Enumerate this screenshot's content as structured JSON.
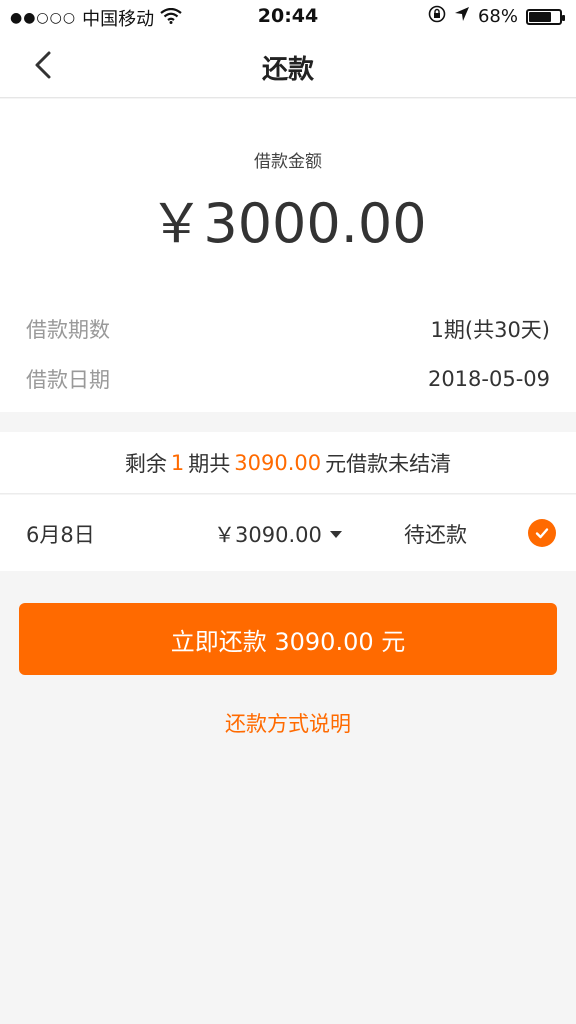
{
  "status_bar": {
    "signal_dots": "●●○○○",
    "carrier": "中国移动",
    "time": "20:44",
    "battery_text": "68%",
    "battery_level": 0.68
  },
  "nav": {
    "title": "还款"
  },
  "loan": {
    "amount_label": "借款金额",
    "amount_value": "￥3000.00",
    "term_label": "借款期数",
    "term_value": "1期(共30天)",
    "date_label": "借款日期",
    "date_value": "2018-05-09"
  },
  "remaining": {
    "prefix": "剩余",
    "count": "1",
    "middle": "期共",
    "amount": "3090.00",
    "suffix": "元借款未结清"
  },
  "installment": {
    "date": "6月8日",
    "amount": "￥3090.00",
    "status": "待还款"
  },
  "actions": {
    "pay_button": "立即还款 3090.00 元",
    "help_link": "还款方式说明"
  },
  "colors": {
    "accent": "#ff6a00"
  }
}
